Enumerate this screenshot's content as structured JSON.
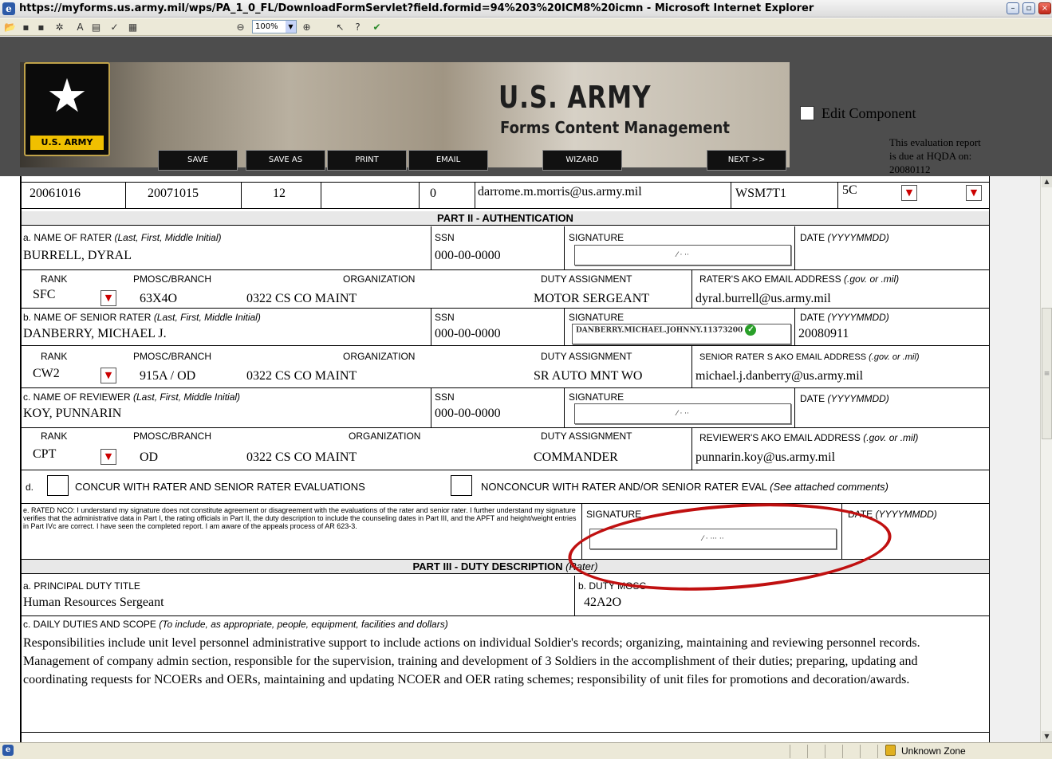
{
  "window": {
    "title": "https://myforms.us.army.mil/wps/PA_1_0_FL/DownloadFormServlet?field.formid=94%203%20ICM8%20icmn - Microsoft Internet Explorer",
    "minimize": "–",
    "restore": "▫",
    "close": "×"
  },
  "toolbar": {
    "zoom": "100%"
  },
  "header": {
    "logo_text": "U.S. ARMY",
    "title": "U.S. ARMY",
    "subtitle": "Forms Content Management",
    "buttons": [
      "SAVE",
      "SAVE AS",
      "PRINT",
      "EMAIL",
      "WIZARD",
      "NEXT >>"
    ],
    "edit_component_label": "Edit Component",
    "due_note": "This evaluation report is due at HQDA on: 20080112"
  },
  "top_row": {
    "from": "20061016",
    "thru": "20071015",
    "months": "12",
    "blank": "",
    "codes": "0",
    "email": "darrome.m.morris@us.army.mil",
    "uic": "WSM7T1",
    "code2": "5C"
  },
  "part2": {
    "title": "PART II - AUTHENTICATION",
    "rater": {
      "name_label_prefix": "a. NAME OF RATER ",
      "name_label_italic": "(Last, First, Middle Initial)",
      "name": "BURRELL, DYRAL",
      "ssn_label": "SSN",
      "ssn": "000-00-0000",
      "sig_label": "SIGNATURE",
      "sig_placeholder": "⁄ · ··",
      "date_label_prefix": "DATE ",
      "date_label_italic": "(YYYYMMDD)",
      "date": "",
      "rank_label": "RANK",
      "rank": "SFC",
      "pmosc_label": "PMOSC/BRANCH",
      "pmosc": "63X4O",
      "org_label": "ORGANIZATION",
      "org": "0322 CS CO MAINT",
      "duty_label": "DUTY ASSIGNMENT",
      "duty": "MOTOR SERGEANT",
      "email_label_prefix": "RATER'S AKO EMAIL ADDRESS ",
      "email_label_italic": "(.gov. or .mil)",
      "email": "dyral.burrell@us.army.mil"
    },
    "senior": {
      "name_label_prefix": "b. NAME OF SENIOR RATER ",
      "name_label_italic": "(Last, First, Middle Initial)",
      "name": "DANBERRY, MICHAEL J.",
      "ssn_label": "SSN",
      "ssn": "000-00-0000",
      "sig_label": "SIGNATURE",
      "signature": "DANBERRY.MICHAEL.JOHNNY.11373200",
      "date_label_prefix": "DATE ",
      "date_label_italic": "(YYYYMMDD)",
      "date": "20080911",
      "rank_label": "RANK",
      "rank": "CW2",
      "pmosc_label": "PMOSC/BRANCH",
      "pmosc": "915A / OD",
      "org_label": "ORGANIZATION",
      "org": "0322 CS CO MAINT",
      "duty_label": "DUTY ASSIGNMENT",
      "duty": "SR AUTO MNT WO",
      "email_label_prefix": "SENIOR RATER S AKO EMAIL ADDRESS ",
      "email_label_italic": "(.gov. or .mil)",
      "email": "michael.j.danberry@us.army.mil"
    },
    "reviewer": {
      "name_label_prefix": "c. NAME OF REVIEWER ",
      "name_label_italic": "(Last, First, Middle Initial)",
      "name": "KOY, PUNNARIN",
      "ssn_label": "SSN",
      "ssn": "000-00-0000",
      "sig_label": "SIGNATURE",
      "sig_placeholder": "⁄ · ··",
      "date_label_prefix": "DATE ",
      "date_label_italic": "(YYYYMMDD)",
      "date": "",
      "rank_label": "RANK",
      "rank": "CPT",
      "pmosc_label": "PMOSC/BRANCH",
      "pmosc": "OD",
      "org_label": "ORGANIZATION",
      "org": "0322 CS CO MAINT",
      "duty_label": "DUTY ASSIGNMENT",
      "duty": "COMMANDER",
      "email_label_prefix": "REVIEWER'S AKO EMAIL ADDRESS ",
      "email_label_italic": "(.gov. or .mil)",
      "email": "punnarin.koy@us.army.mil"
    },
    "concur": {
      "d_label": "d.",
      "concur_label": "CONCUR WITH RATER AND SENIOR RATER EVALUATIONS",
      "nonconcur_label": "NONCONCUR WITH RATER AND/OR SENIOR RATER EVAL ",
      "nonconcur_italic": "(See attached comments)"
    },
    "rated_nco": {
      "text": "e. RATED NCO: I understand my signature does not constitute agreement or disagreement with the evaluations of the rater and senior rater. I further understand my signature verifies that the administrative data in Part I, the rating officials in Part II, the duty description to include the counseling dates in Part III, and the APFT and height/weight entries in Part IVc are correct. I have seen the completed report. I am aware of the appeals process of AR 623-3.",
      "sig_label": "SIGNATURE",
      "sig_placeholder": "⁄ · ··· ··",
      "date_label_prefix": "DATE ",
      "date_label_italic": "(YYYYMMDD)"
    }
  },
  "part3": {
    "title": "PART III - DUTY DESCRIPTION",
    "title_suffix": "(Rater)",
    "duty_title_label": "a. PRINCIPAL DUTY TITLE",
    "duty_title": "Human Resources Sergeant",
    "duty_mosc_label": "b. DUTY MOSC",
    "duty_mosc": "42A2O",
    "daily_label_prefix": "c. DAILY DUTIES AND SCOPE ",
    "daily_label_italic": "(To include, as appropriate, people, equipment, facilities and dollars)",
    "daily_text": "Responsibilities include unit level personnel administrative support to include actions on individual Soldier's  records; organizing, maintaining and reviewing personnel records. Management of company admin section, responsible for the supervision, training and development of 3 Soldiers in the accomplishment of their duties; preparing, updating and coordinating requests for NCOERs and OERs, maintaining and updating NCOER and OER rating schemes; responsibility of unit files for promotions and decoration/awards."
  },
  "status": {
    "zone": "Unknown Zone"
  },
  "colors": {
    "annotation": "#c01010",
    "header_bg": "#4d4d4d",
    "dropdown_arrow": "#cc0000"
  }
}
